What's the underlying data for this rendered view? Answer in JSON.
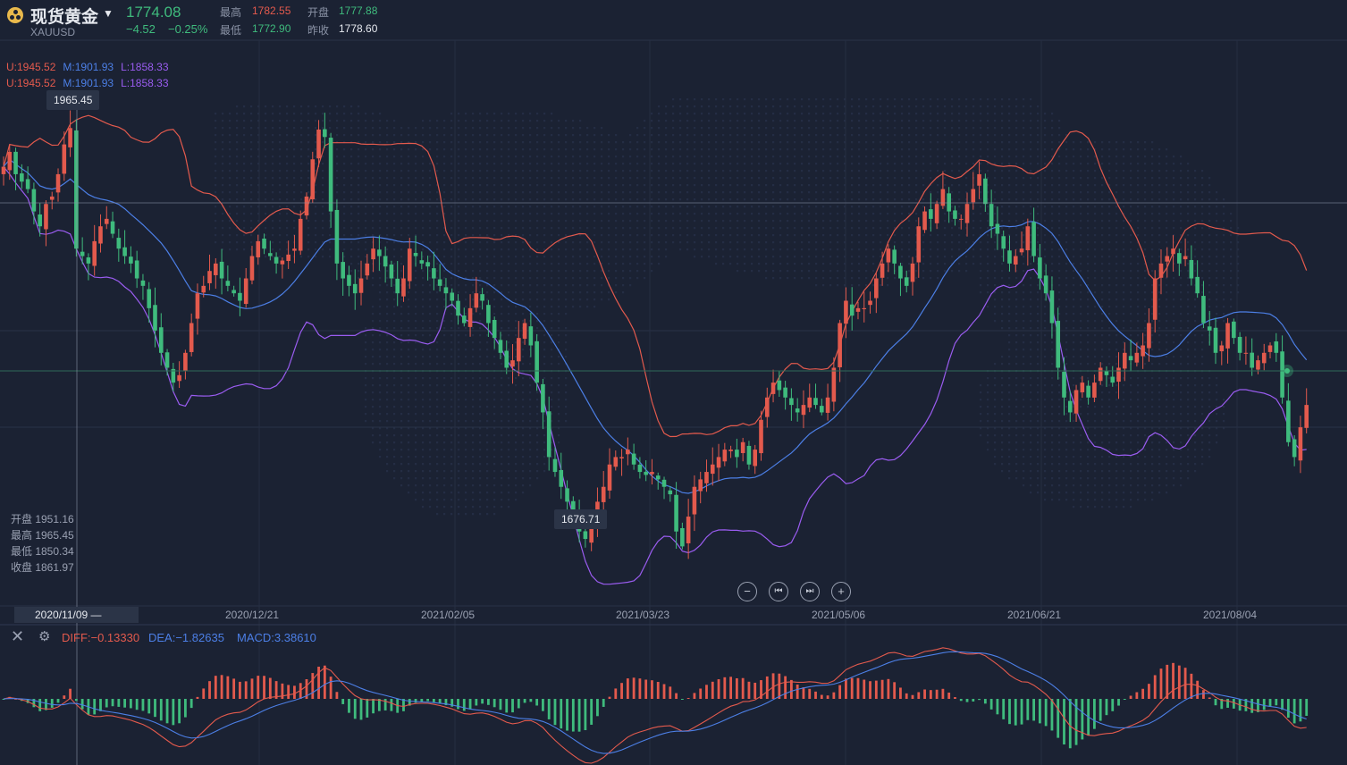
{
  "header": {
    "title": "现货黄金",
    "symbol": "XAUUSD",
    "price": "1774.08",
    "change": "−4.52",
    "change_pct": "−0.25%",
    "high_label": "最高",
    "high": "1782.55",
    "open_label": "开盘",
    "open": "1777.88",
    "low_label": "最低",
    "low": "1772.90",
    "prev_close_label": "昨收",
    "prev_close": "1778.60"
  },
  "boll_legend": [
    {
      "u": "U:1945.52",
      "m": "M:1901.93",
      "l": "L:1858.33"
    },
    {
      "u": "U:1945.52",
      "m": "M:1901.93",
      "l": "L:1858.33"
    }
  ],
  "crosshair_tag": "1965.45",
  "low_tag": "1676.71",
  "ohlc_panel": {
    "open": "开盘 1951.16",
    "high": "最高 1965.45",
    "low": "最低 1850.34",
    "close": "收盘 1861.97"
  },
  "x_axis": {
    "current": "2020/11/09 —",
    "labels": [
      "2020/12/21",
      "2021/02/05",
      "2021/03/23",
      "2021/05/06",
      "2021/06/21",
      "2021/08/04"
    ]
  },
  "controls": {
    "zoom_out": "−",
    "prev": "⏮",
    "next": "⏭",
    "zoom_in": "+"
  },
  "macd_legend": {
    "diff": "DIFF:−0.13330",
    "dea": "DEA:−1.82635",
    "macd": "MACD:3.38610"
  },
  "colors": {
    "up": "#e35a4d",
    "down": "#3fbb7d",
    "mid": "#4c7fe6",
    "lower": "#9a5cf0",
    "upper": "#e35a4d",
    "bg": "#1b2233"
  },
  "chart_data": {
    "type": "line",
    "title": "",
    "description": "Candlestick chart of XAUUSD with Bollinger Bands and MACD sub-panel",
    "ylim": [
      1640,
      2020
    ],
    "closes": [
      1935,
      1945,
      1930,
      1925,
      1920,
      1905,
      1895,
      1910,
      1915,
      1930,
      1950,
      1961,
      1880,
      1875,
      1870,
      1885,
      1895,
      1900,
      1890,
      1880,
      1875,
      1870,
      1860,
      1855,
      1840,
      1825,
      1810,
      1800,
      1790,
      1795,
      1810,
      1830,
      1850,
      1855,
      1865,
      1870,
      1860,
      1855,
      1850,
      1845,
      1860,
      1875,
      1885,
      1880,
      1875,
      1870,
      1872,
      1876,
      1880,
      1900,
      1915,
      1940,
      1960,
      1955,
      1905,
      1870,
      1860,
      1855,
      1850,
      1860,
      1870,
      1880,
      1875,
      1868,
      1860,
      1850,
      1860,
      1880,
      1875,
      1870,
      1868,
      1860,
      1855,
      1850,
      1845,
      1835,
      1830,
      1840,
      1850,
      1845,
      1830,
      1820,
      1810,
      1800,
      1805,
      1820,
      1830,
      1815,
      1790,
      1770,
      1740,
      1730,
      1720,
      1710,
      1700,
      1690,
      1685,
      1695,
      1710,
      1720,
      1735,
      1740,
      1740,
      1745,
      1735,
      1730,
      1728,
      1730,
      1725,
      1720,
      1715,
      1690,
      1680,
      1700,
      1720,
      1725,
      1730,
      1735,
      1740,
      1745,
      1745,
      1740,
      1750,
      1735,
      1745,
      1765,
      1780,
      1790,
      1785,
      1780,
      1775,
      1770,
      1775,
      1780,
      1775,
      1770,
      1780,
      1800,
      1830,
      1845,
      1835,
      1840,
      1840,
      1845,
      1860,
      1870,
      1880,
      1870,
      1860,
      1855,
      1870,
      1895,
      1905,
      1900,
      1910,
      1920,
      1905,
      1900,
      1900,
      1910,
      1920,
      1930,
      1910,
      1895,
      1890,
      1880,
      1870,
      1875,
      1880,
      1895,
      1875,
      1860,
      1850,
      1830,
      1800,
      1780,
      1770,
      1785,
      1790,
      1780,
      1790,
      1800,
      1795,
      1790,
      1800,
      1810,
      1805,
      1810,
      1815,
      1830,
      1860,
      1870,
      1875,
      1880,
      1870,
      1875,
      1860,
      1850,
      1830,
      1825,
      1810,
      1815,
      1830,
      1820,
      1810,
      1810,
      1800,
      1805,
      1810,
      1815,
      1810,
      1780,
      1750,
      1740,
      1760,
      1775
    ],
    "series": [
      {
        "name": "U",
        "values": [
          1945.52
        ]
      },
      {
        "name": "M",
        "values": [
          1901.93
        ]
      },
      {
        "name": "L",
        "values": [
          1858.33
        ]
      }
    ],
    "macd": {
      "diff": -0.1333,
      "dea": -1.82635,
      "macd": 3.3861
    },
    "x_ticks": [
      "2020/11/09",
      "2020/12/21",
      "2021/02/05",
      "2021/03/23",
      "2021/05/06",
      "2021/06/21",
      "2021/08/04"
    ]
  }
}
